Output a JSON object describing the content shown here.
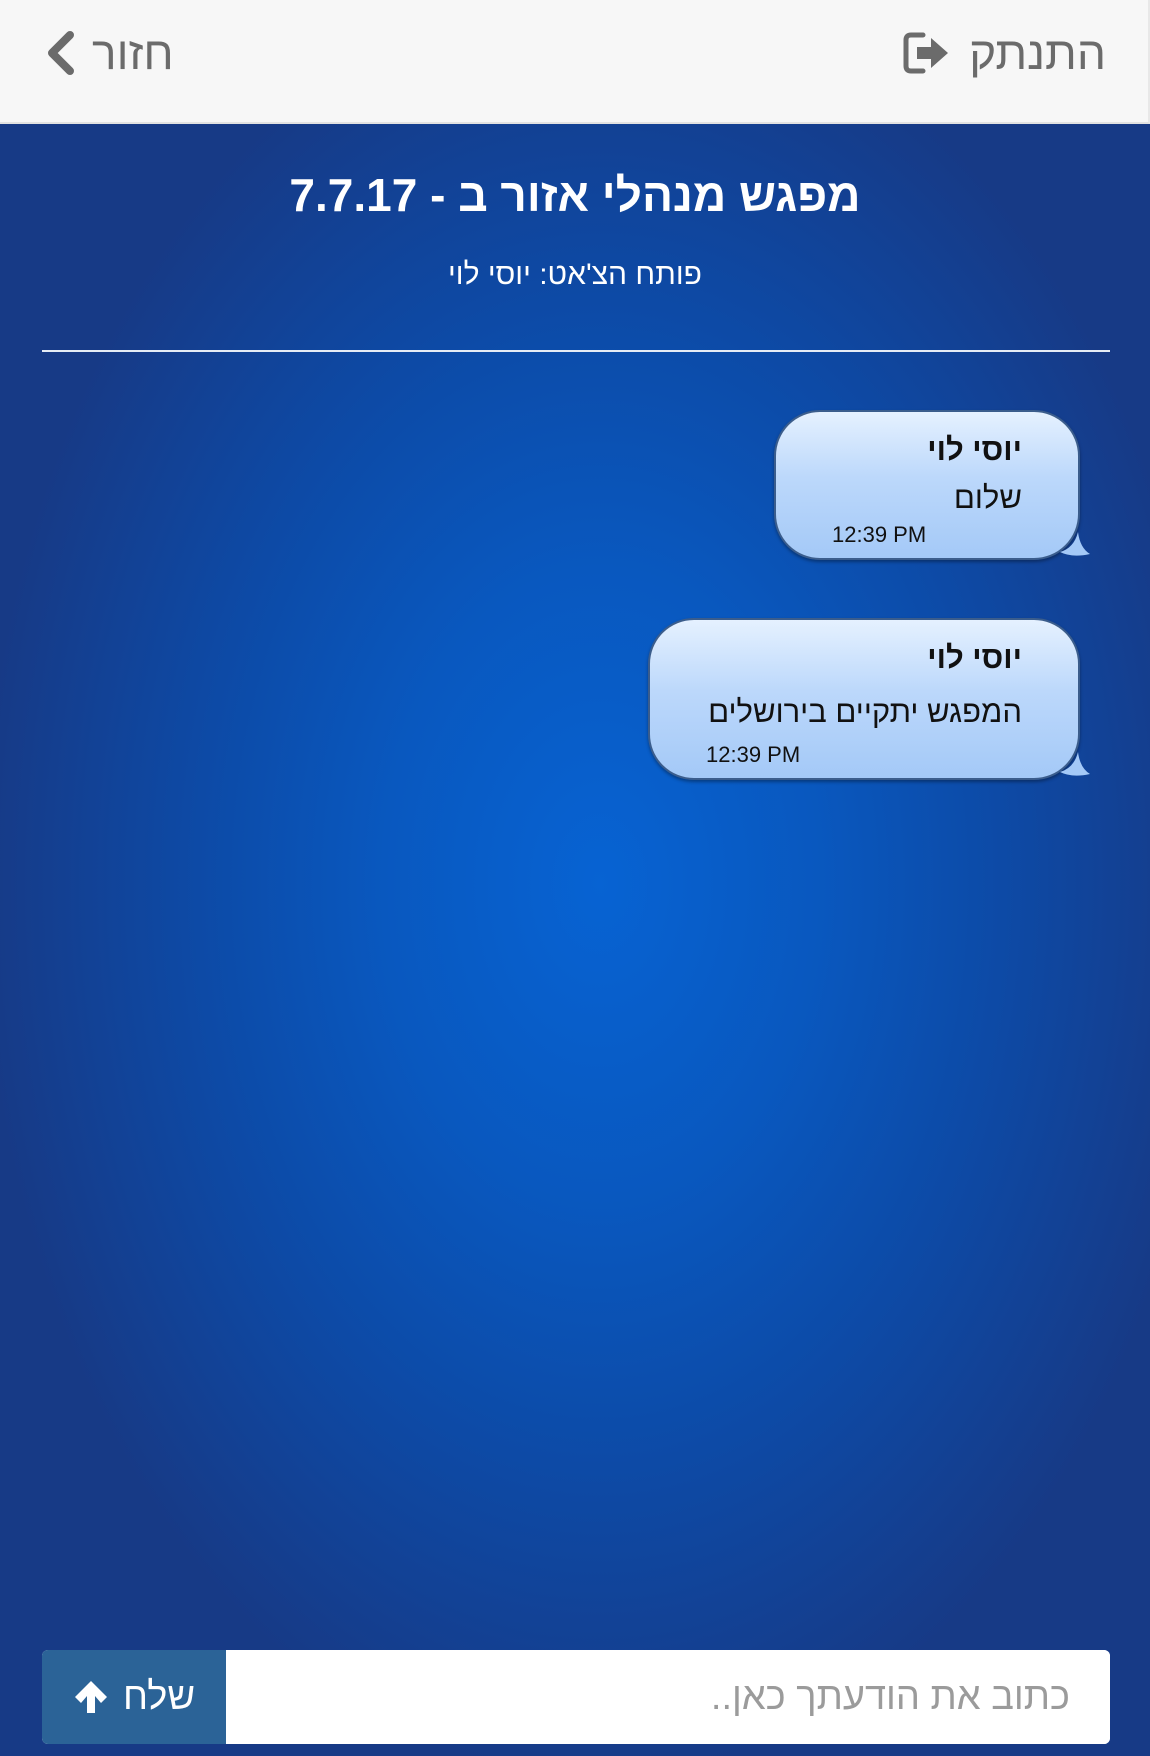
{
  "header": {
    "logout_label": "התנתק",
    "back_label": "חזור"
  },
  "chat": {
    "title": "מפגש מנהלי אזור ב - 7.7.17",
    "opener": "פותח הצ'אט: יוסי לוי",
    "messages": [
      {
        "sender": "יוסי לוי",
        "text": "שלום",
        "time": "12:39 PM"
      },
      {
        "sender": "יוסי לוי",
        "text": "המפגש יתקיים בירושלים",
        "time": "12:39 PM"
      }
    ]
  },
  "composer": {
    "placeholder": "כתוב את הודעתך כאן..",
    "value": "",
    "send_label": "שלח"
  },
  "icons": {
    "logout": "sign-out-icon",
    "back": "chevron-left-icon",
    "send": "arrow-up-icon"
  },
  "colors": {
    "header_bg": "#f7f7f7",
    "header_text": "#6b6b6b",
    "chat_bg_center": "#0763d3",
    "chat_bg_edge": "#173a86",
    "bubble_light": "#e5f1ff",
    "bubble_dark": "#a4c9f7",
    "send_button": "#2b6397"
  }
}
